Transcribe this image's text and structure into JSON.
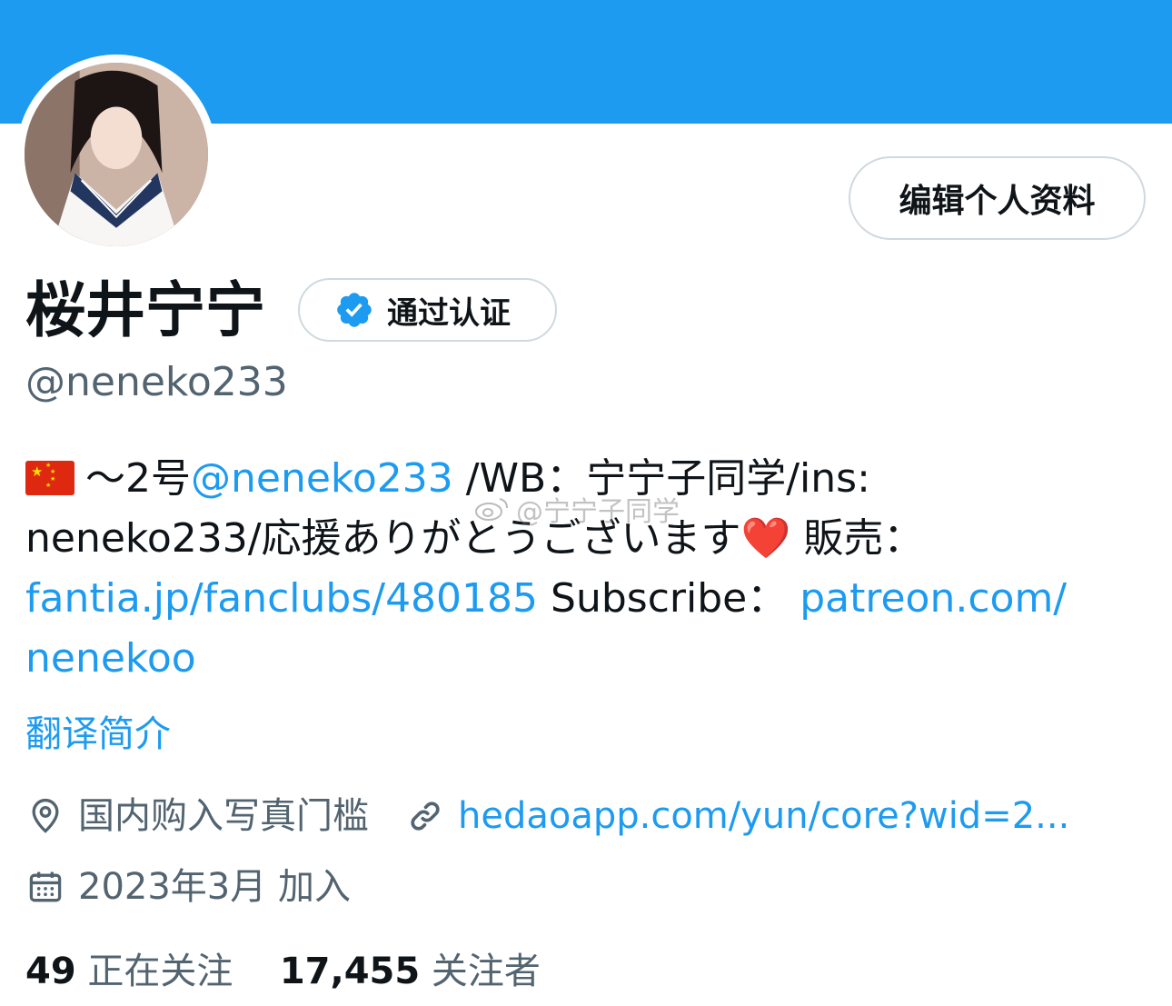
{
  "profile": {
    "display_name": "桜井宁宁",
    "verified_label": "通过认证",
    "handle": "@neneko233",
    "edit_button": "编辑个人资料",
    "bio": {
      "seg1": "～2号",
      "mention": "@neneko233",
      "seg2": " /WB：宁宁子同学/ins:",
      "line2_text": "neneko233/応援ありがとうございます",
      "heart": "❤️",
      "line2_tail": " 販売：",
      "link1": "fantia.jp/fanclubs/480185",
      "seg3": " Subscribe：",
      "link2_part1": "patreon.com/",
      "link2_part2": "nenekoo"
    },
    "translate_label": "翻译简介",
    "location": "国内购入写真门槛",
    "website": "hedaoapp.com/yun/core?wid=2...",
    "joined": "2023年3月 加入",
    "following_count": "49",
    "following_label": "正在关注",
    "followers_count": "17,455",
    "followers_label": "关注者",
    "watermark": "@宁宁子同学"
  },
  "icons": {
    "location": "location-pin-icon",
    "link": "link-icon",
    "calendar": "calendar-icon",
    "verified": "verified-badge-icon",
    "flag": "china-flag-icon"
  },
  "colors": {
    "banner": "#1d9bf0",
    "link": "#1d9bf0",
    "secondary_text": "#536471",
    "primary_text": "#0f1419"
  }
}
